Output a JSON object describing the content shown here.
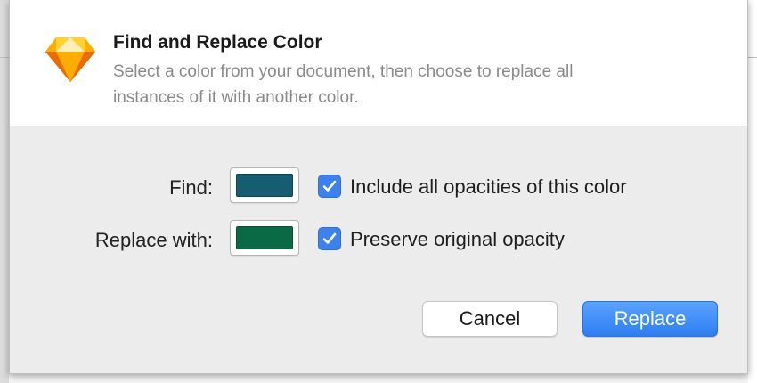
{
  "dialog": {
    "title": "Find and Replace Color",
    "description": "Select a color from your document, then choose to replace all instances of it with another color.",
    "logo_icon": "sketch-diamond-icon"
  },
  "find_row": {
    "label": "Find:",
    "swatch_color": "#155e72",
    "checkbox_checked": true,
    "checkbox_label": "Include all opacities of this color"
  },
  "replace_row": {
    "label": "Replace with:",
    "swatch_color": "#0b6a46",
    "checkbox_checked": true,
    "checkbox_label": "Preserve original opacity"
  },
  "buttons": {
    "cancel_label": "Cancel",
    "replace_label": "Replace"
  },
  "colors": {
    "accent": "#3b82f0",
    "primary_button": "#2e7df2"
  }
}
